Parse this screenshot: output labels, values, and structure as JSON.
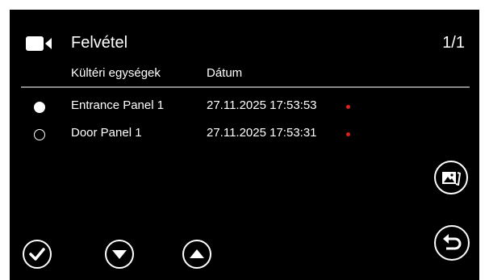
{
  "header": {
    "icon": "video-camera-icon",
    "title": "Felvétel",
    "page_indicator": "1/1"
  },
  "table": {
    "columns": [
      "Kültéri egységek",
      "Dátum"
    ],
    "rows": [
      {
        "name": "Entrance Panel 1",
        "date": "27.11.2025 17:53:53",
        "selected": true,
        "new": true
      },
      {
        "name": "Door Panel 1",
        "date": "27.11.2025 17:53:31",
        "selected": false,
        "new": true
      }
    ]
  },
  "buttons": {
    "gallery": "gallery-icon",
    "back": "back-arrow-icon",
    "check": "check-icon",
    "down": "arrow-down-icon",
    "up": "arrow-up-icon"
  },
  "colors": {
    "background": "#000000",
    "text": "#ffffff",
    "divider": "#8a8a8a",
    "new_indicator": "#e0201e"
  }
}
